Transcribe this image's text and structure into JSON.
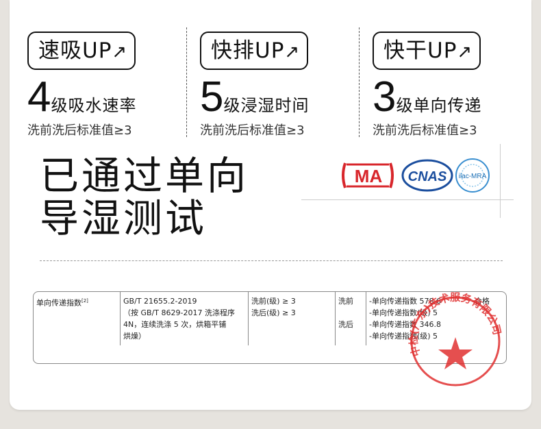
{
  "features": [
    {
      "pill": "速吸UP",
      "arrow": "↗",
      "level": "4",
      "metric": "级吸水速率",
      "standard": "洗前洗后标准值≥3"
    },
    {
      "pill": "快排UP",
      "arrow": "↗",
      "level": "5",
      "metric": "级浸湿时间",
      "standard": "洗前洗后标准值≥3"
    },
    {
      "pill": "快干UP",
      "arrow": "↗",
      "level": "3",
      "metric": "级单向传递",
      "standard": "洗前洗后标准值≥3"
    }
  ],
  "headline": {
    "line1": "已通过单向",
    "line2": "导湿测试"
  },
  "logos": {
    "cma": "MA",
    "cnas": "CNAS",
    "ilac": "ilac-MRA"
  },
  "report": {
    "item": "单向传递指数",
    "item_note": "[2]",
    "method": [
      "GB/T 21655.2-2019",
      "（按 GB/T 8629-2017 洗涤程序",
      "4N，连续洗涤 5 次，烘箱平铺",
      "烘燥）"
    ],
    "requirement": [
      "洗前(级) ≥ 3",
      "洗后(级) ≥ 3"
    ],
    "phase_before": "洗前",
    "phase_after": "洗后",
    "results": [
      "-单向传递指数    578.6",
      "-单向传递指数(级) 5",
      "-单向传递指数    346.8",
      "-单向传递指数(级) 5"
    ],
    "verdict": "合格"
  },
  "stamp": {
    "text": "中检(广东)技术服务有限公司",
    "color": "#e03030"
  }
}
